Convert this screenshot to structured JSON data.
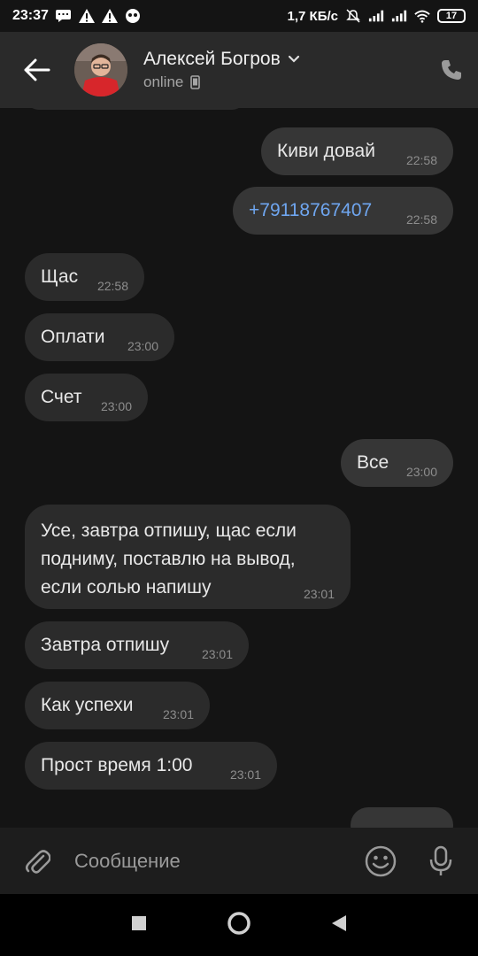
{
  "status_bar": {
    "time": "23:37",
    "net_speed": "1,7 КБ/с",
    "battery": "17"
  },
  "header": {
    "contact_name": "Алексей Богров",
    "presence": "online"
  },
  "messages": [
    {
      "dir": "out",
      "text": "Киви довай",
      "time": "22:58"
    },
    {
      "dir": "out",
      "text": "+79118767407",
      "time": "22:58",
      "link": true
    },
    {
      "dir": "in",
      "text": "Щас",
      "time": "22:58"
    },
    {
      "dir": "in",
      "text": "Оплати",
      "time": "23:00"
    },
    {
      "dir": "in",
      "text": "Счет",
      "time": "23:00"
    },
    {
      "dir": "out",
      "text": "Все",
      "time": "23:00"
    },
    {
      "dir": "in",
      "lines": [
        "Усе, завтра отпишу, щас если",
        "подниму, поставлю на вывод,",
        "если солью напишу"
      ],
      "time": "23:01"
    },
    {
      "dir": "in",
      "text": "Завтра отпишу",
      "time": "23:01"
    },
    {
      "dir": "in",
      "text": "Как успехи",
      "time": "23:01"
    },
    {
      "dir": "in",
      "text": "Прост время 1:00",
      "time": "23:01"
    }
  ],
  "composer": {
    "placeholder": "Сообщение"
  },
  "icons": {
    "back": "arrow-left-icon",
    "call": "phone-icon",
    "attach": "paperclip-icon",
    "emoji": "smile-icon",
    "voice": "microphone-icon",
    "presence_device": "mobile-phone-icon"
  },
  "colors": {
    "background": "#141414",
    "header": "#2a2a2a",
    "incoming_bubble": "#2b2b2b",
    "outgoing_bubble": "#363636",
    "link": "#6fa6f0",
    "timestamp": "#8d8d8d"
  }
}
